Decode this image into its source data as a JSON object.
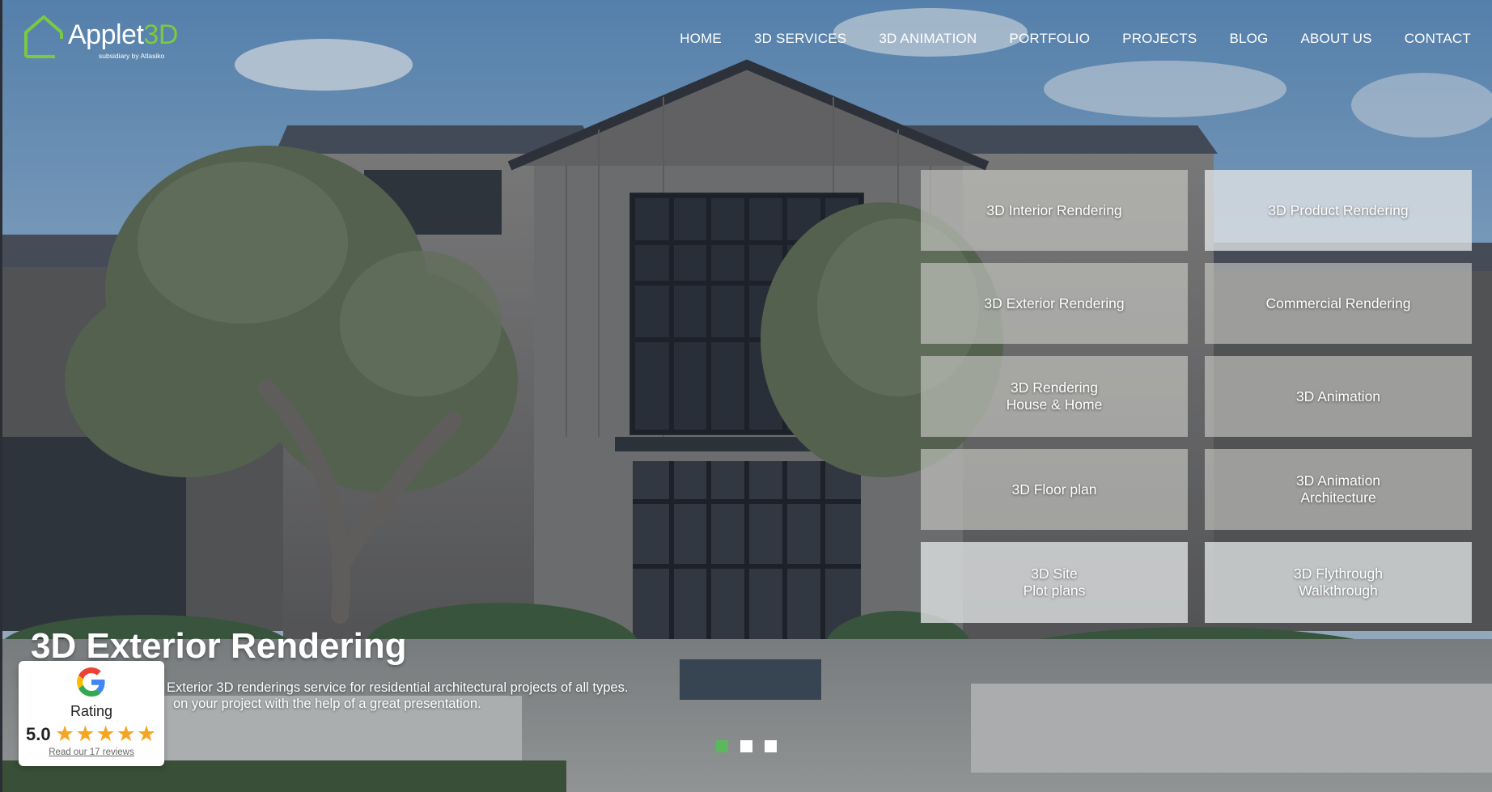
{
  "logo": {
    "brand_main": "Applet",
    "brand_accent": "3D",
    "subtitle": "subsidiary by Atlasiko"
  },
  "nav": {
    "home": "HOME",
    "services": "3D SERVICES",
    "animation": "3D ANIMATION",
    "portfolio": "PORTFOLIO",
    "projects": "PROJECTS",
    "blog": "BLOG",
    "about": "ABOUT US",
    "contact": "CONTACT"
  },
  "services": [
    "3D Interior Rendering",
    "3D Product Rendering",
    "3D Exterior Rendering",
    "Commercial Rendering",
    "3D Rendering\nHouse & Home",
    "3D Animation",
    "3D Floor plan",
    "3D Animation\nArchitecture",
    "3D Site\nPlot plans",
    "3D Flythrough\nWalkthrough"
  ],
  "slide": {
    "title": "3D Exterior Rendering",
    "line1": "Exterior 3D renderings service for residential architectural projects of all types.",
    "line2": "on your project with the help of a great presentation."
  },
  "slider": {
    "count": 3,
    "active": 1
  },
  "rating": {
    "label": "Rating",
    "score": "5.0",
    "stars": 5,
    "reviews": "Read our 17 reviews"
  },
  "colors": {
    "accent_green": "#7ac943",
    "dot_active": "#5cb85c",
    "star": "#f4a622"
  }
}
